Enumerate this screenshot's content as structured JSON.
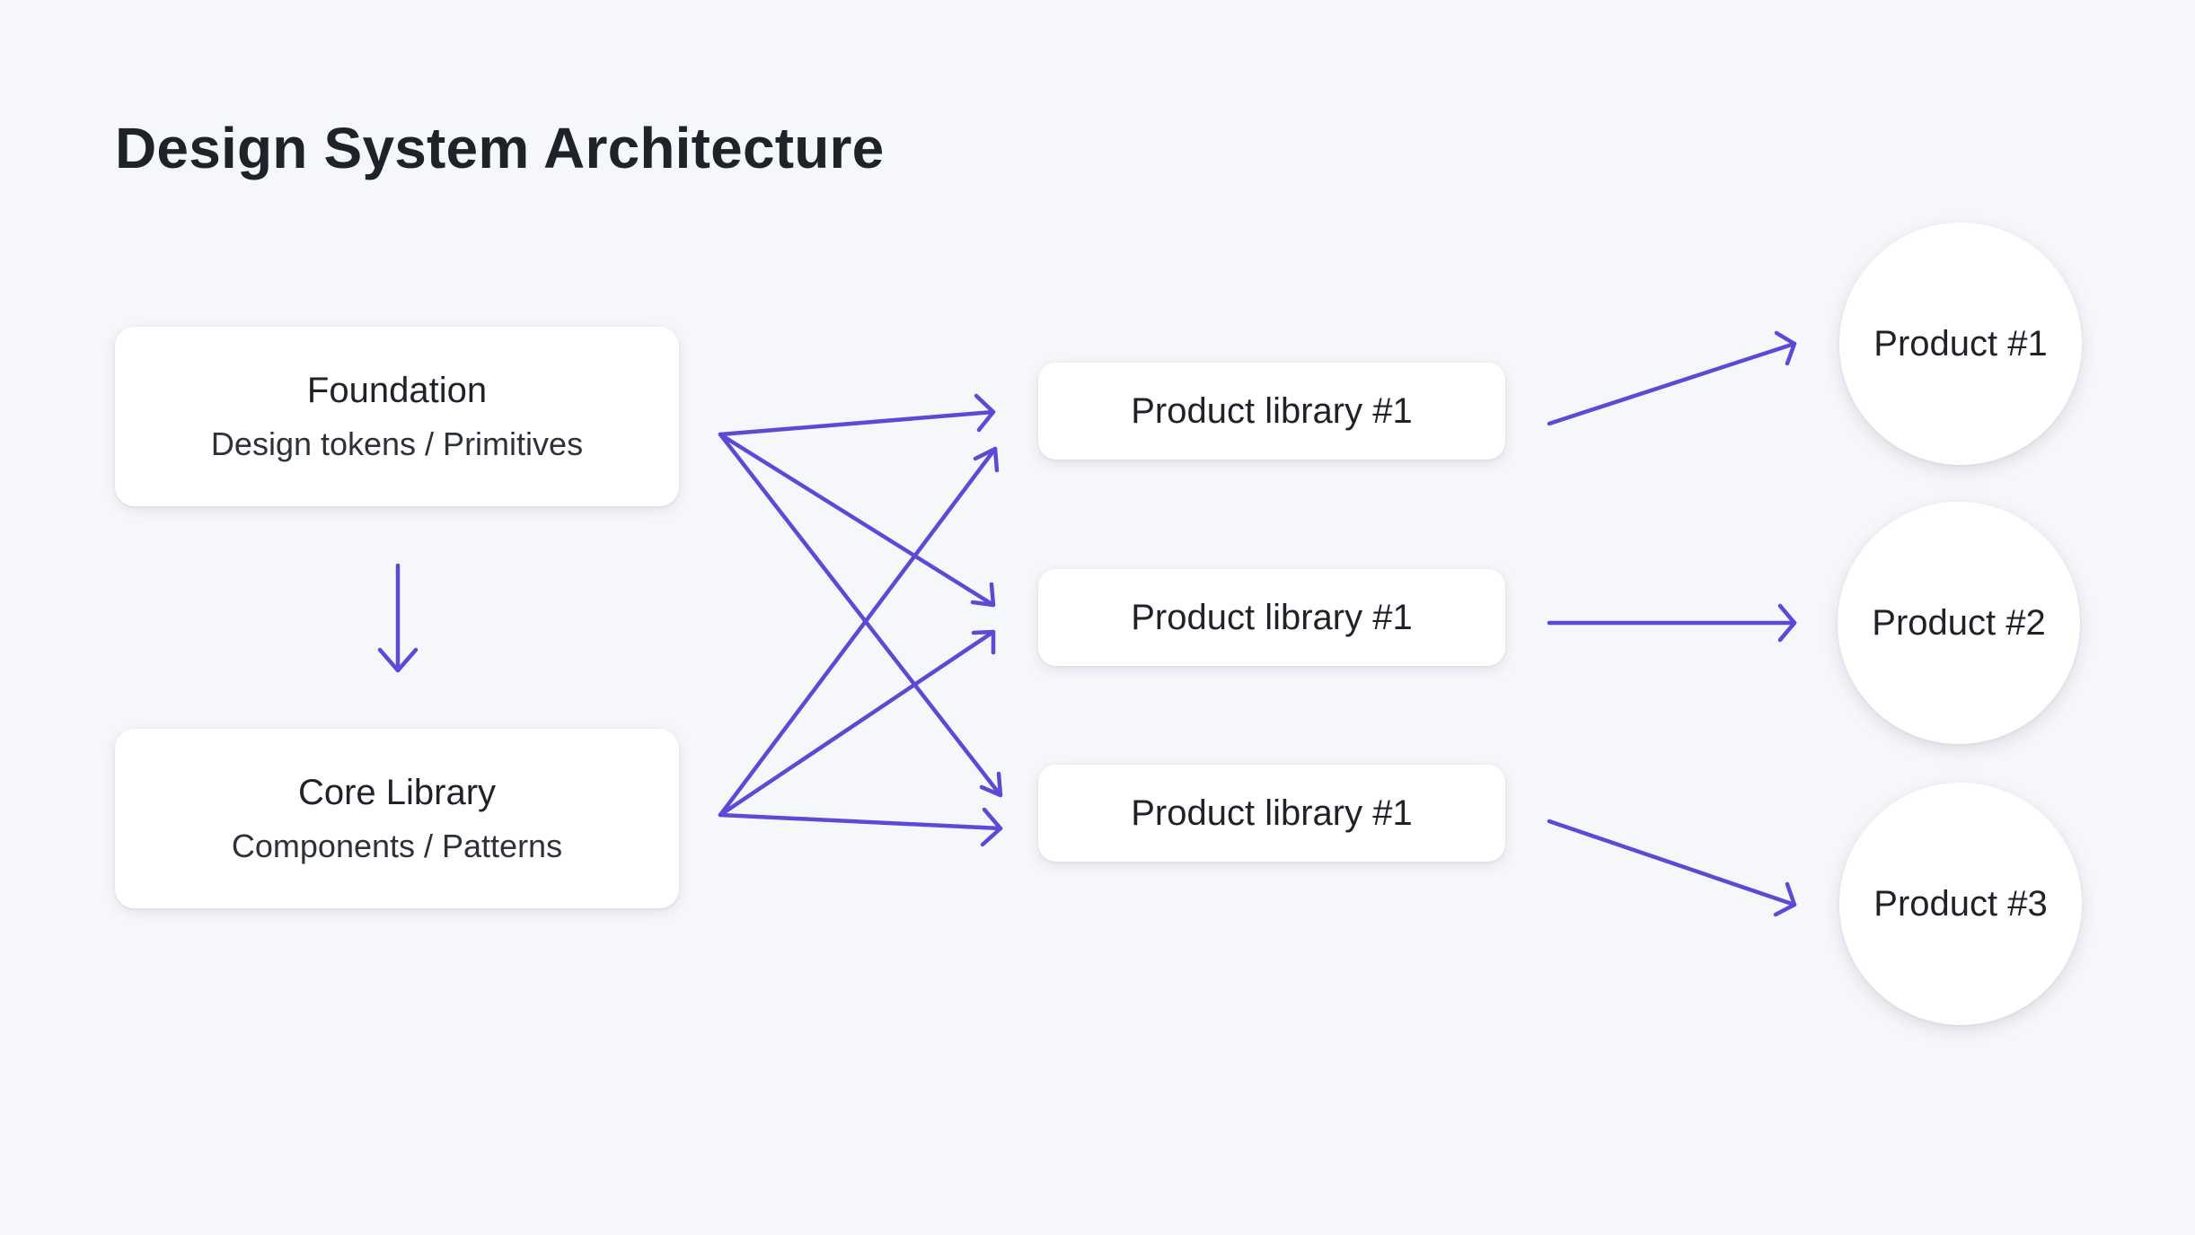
{
  "title": "Design System Architecture",
  "accent_color": "#5b4ad6",
  "foundation": {
    "title": "Foundation",
    "subtitle": "Design tokens / Primitives"
  },
  "core_library": {
    "title": "Core Library",
    "subtitle": "Components / Patterns"
  },
  "product_libraries": [
    {
      "label": "Product library #1"
    },
    {
      "label": "Product library #1"
    },
    {
      "label": "Product library #1"
    }
  ],
  "products": [
    {
      "label": "Product #1"
    },
    {
      "label": "Product #2"
    },
    {
      "label": "Product #3"
    }
  ]
}
